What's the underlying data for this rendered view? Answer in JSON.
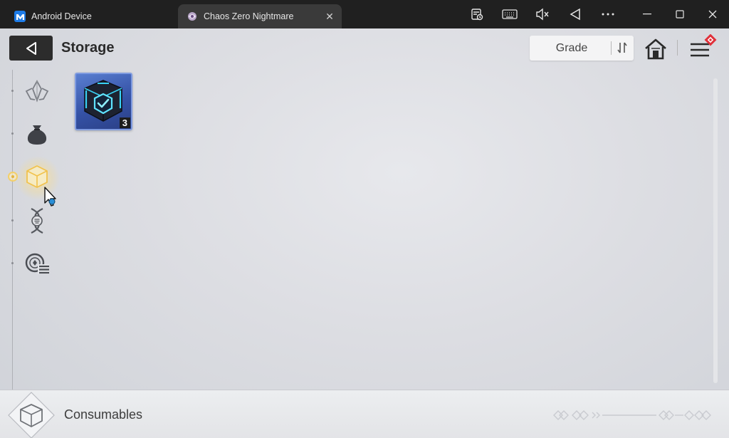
{
  "window": {
    "tabs": [
      {
        "label": "Android Device"
      },
      {
        "label": "Chaos Zero Nightmare"
      }
    ],
    "tab_close_glyph": "✕",
    "toolbar_icons": [
      "screenshot-icon",
      "keyboard-icon",
      "mute-icon",
      "back-icon",
      "more-icon"
    ],
    "window_controls": [
      "minimize-icon",
      "maximize-icon",
      "close-icon"
    ]
  },
  "header": {
    "title": "Storage",
    "sort_label": "Grade"
  },
  "sidebar": {
    "items": [
      {
        "icon": "crystal-icon",
        "active": false
      },
      {
        "icon": "pouch-icon",
        "active": false
      },
      {
        "icon": "cube-icon",
        "active": true
      },
      {
        "icon": "dna-icon",
        "active": false
      },
      {
        "icon": "disc-list-icon",
        "active": false
      }
    ]
  },
  "items": [
    {
      "icon": "tech-cube-icon",
      "count": "3",
      "grade_color": "#3552a6"
    }
  ],
  "footer": {
    "category": "Consumables"
  },
  "colors": {
    "accent_gold": "#f3cf6a",
    "badge_red": "#e0303a"
  }
}
